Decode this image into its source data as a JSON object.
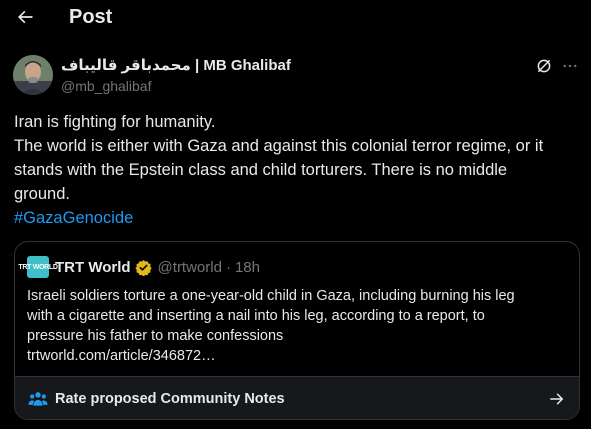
{
  "header": {
    "title": "Post",
    "back_icon": "arrow-left-icon"
  },
  "author": {
    "name": "محمدباقر قالیباف | MB Ghalibaf",
    "handle": "@mb_ghalibaf",
    "avatar_icon": "profile-photo"
  },
  "actions": {
    "grok_icon": "grok-icon",
    "more_icon": "more-dots-icon"
  },
  "tweet": {
    "lines": [
      "Iran is fighting for humanity.",
      "The world is either with Gaza and against this colonial terror regime, or it",
      "stands with the Epstein class and child torturers. There is no middle",
      "ground."
    ],
    "hashtag": "#GazaGenocide"
  },
  "quote": {
    "logo_text": "TRT WORLD",
    "name": "TRT World",
    "handle": "@trtworld",
    "separator": "·",
    "time": "18h",
    "lines": [
      "Israeli soldiers torture a one-year-old child in Gaza, including burning his leg",
      "with a cigarette and inserting a nail into his leg, according to a report, to",
      "pressure his father to make confessions",
      "trtworld.com/article/346872…"
    ]
  },
  "community_notes": {
    "label": "Rate proposed Community Notes",
    "icon": "people-icon",
    "arrow_icon": "arrow-right-icon"
  },
  "colors": {
    "background": "#000000",
    "text": "#e7e9ea",
    "muted": "#71767b",
    "link": "#1d9bf0",
    "border": "#2f3336",
    "notes_bg": "#16181c",
    "verified_gold": "#e2b719"
  }
}
